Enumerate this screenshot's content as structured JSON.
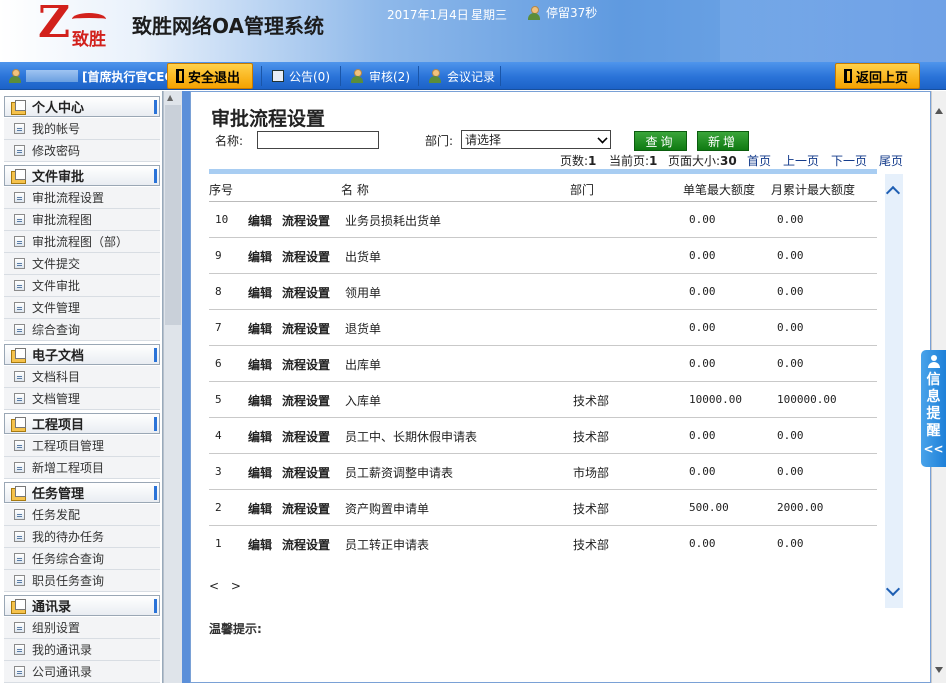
{
  "header": {
    "logo_letter": "Z",
    "logo_text": "致胜",
    "system_title": "致胜网络OA管理系统",
    "date": "2017年1月4日",
    "weekday": "星期三",
    "stay_text": "停留37秒"
  },
  "toolbar": {
    "user_role": "[首席执行官CEO]",
    "logout_label": "安全退出",
    "notice_label": "公告(0)",
    "audit_label": "审核(2)",
    "meeting_label": "会议记录",
    "back_label": "返回上页"
  },
  "sidebar": {
    "groups": [
      {
        "title": "个人中心",
        "items": [
          "我的帐号",
          "修改密码"
        ]
      },
      {
        "title": "文件审批",
        "items": [
          "审批流程设置",
          "审批流程图",
          "审批流程图（部）",
          "文件提交",
          "文件审批",
          "文件管理",
          "综合查询"
        ]
      },
      {
        "title": "电子文档",
        "items": [
          "文档科目",
          "文档管理"
        ]
      },
      {
        "title": "工程项目",
        "items": [
          "工程项目管理",
          "新增工程项目"
        ]
      },
      {
        "title": "任务管理",
        "items": [
          "任务发配",
          "我的待办任务",
          "任务综合查询",
          "职员任务查询"
        ]
      },
      {
        "title": "通讯录",
        "items": [
          "组别设置",
          "我的通讯录",
          "公司通讯录"
        ]
      }
    ]
  },
  "main": {
    "title": "审批流程设置",
    "name_label": "名称:",
    "name_value": "",
    "dept_label": "部门:",
    "dept_selected": "请选择",
    "query_label": "查询",
    "add_label": "新增",
    "pager": {
      "pages_label": "页数:",
      "pages": "1",
      "current_label": "当前页:",
      "current": "1",
      "size_label": "页面大小:",
      "size": "30",
      "first": "首页",
      "prev": "上一页",
      "next": "下一页",
      "last": "尾页"
    },
    "columns": [
      "序号",
      "名 称",
      "部门",
      "单笔最大额度",
      "月累计最大额度"
    ],
    "edit_label": "编辑",
    "flow_label": "流程设置",
    "rows": [
      {
        "id": "10",
        "name": "业务员损耗出货单",
        "dept": "",
        "single": "0.00",
        "monthly": "0.00"
      },
      {
        "id": "9",
        "name": "出货单",
        "dept": "",
        "single": "0.00",
        "monthly": "0.00"
      },
      {
        "id": "8",
        "name": "领用单",
        "dept": "",
        "single": "0.00",
        "monthly": "0.00"
      },
      {
        "id": "7",
        "name": "退货单",
        "dept": "",
        "single": "0.00",
        "monthly": "0.00"
      },
      {
        "id": "6",
        "name": "出库单",
        "dept": "",
        "single": "0.00",
        "monthly": "0.00"
      },
      {
        "id": "5",
        "name": "入库单",
        "dept": "技术部",
        "single": "10000.00",
        "monthly": "100000.00"
      },
      {
        "id": "4",
        "name": "员工中、长期休假申请表",
        "dept": "技术部",
        "single": "0.00",
        "monthly": "0.00"
      },
      {
        "id": "3",
        "name": "员工薪资调整申请表",
        "dept": "市场部",
        "single": "0.00",
        "monthly": "0.00"
      },
      {
        "id": "2",
        "name": "资产购置申请单",
        "dept": "技术部",
        "single": "500.00",
        "monthly": "2000.00"
      },
      {
        "id": "1",
        "name": "员工转正申请表",
        "dept": "技术部",
        "single": "0.00",
        "monthly": "0.00"
      }
    ],
    "hscroll_nav": "< >",
    "tip_label": "温馨提示:"
  },
  "info_tab": {
    "label": "信息提醒",
    "collapse": "<<"
  }
}
